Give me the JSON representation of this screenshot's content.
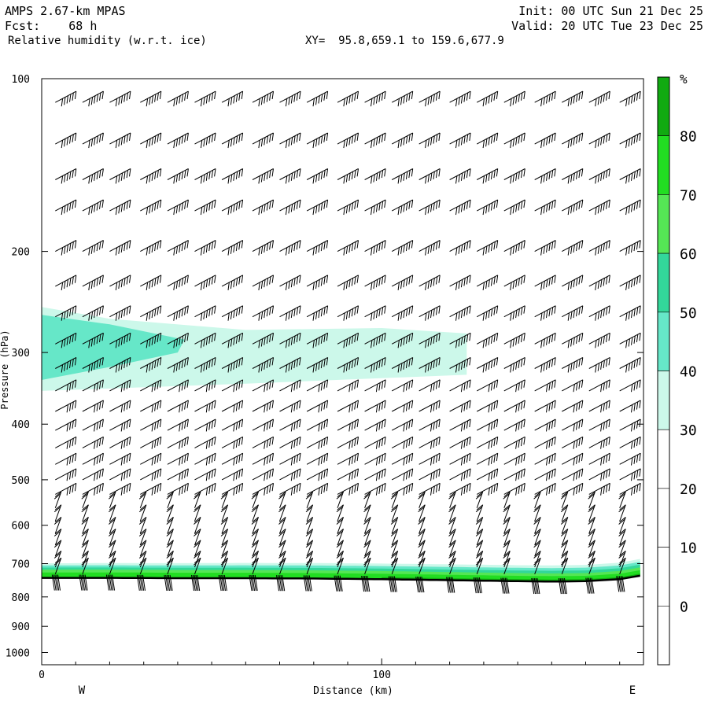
{
  "header": {
    "line1_left": "AMPS 2.67-km MPAS",
    "line2_left": "Fcst:    68 h",
    "line3_left": "Relative humidity (w.r.t. ice)",
    "line3_mid": "XY=  95.8,659.1 to 159.6,677.9",
    "line1_right": "Init: 00 UTC Sun 21 Dec 25",
    "line2_right": "Valid: 20 UTC Tue 23 Dec 25"
  },
  "colors": {
    "rh_20_30": "#ffffff",
    "rh_30_40": "#ccf8ea",
    "rh_40_50": "#66e7c8",
    "rh_50_60": "#33d79a",
    "rh_60_70": "#55e655",
    "rh_70_80": "#22dd22",
    "rh_80_plus": "#11aa11",
    "terrain_line": "#000000",
    "barb": "#000000"
  },
  "chart_data": {
    "type": "heatmap",
    "field": "Relative humidity (w.r.t. ice)",
    "xlabel": "Distance (km)",
    "ylabel": "Pressure (hPa)",
    "xlim": [
      0,
      177
    ],
    "ylim": [
      1050,
      100
    ],
    "y_scale": "log",
    "x_ticks": [
      0,
      100
    ],
    "y_ticks": [
      100,
      200,
      300,
      400,
      500,
      600,
      700,
      800,
      900,
      1000
    ],
    "x_end_labels": {
      "west": "W",
      "east": "E"
    },
    "grid": false,
    "colorbar": {
      "unit": "%",
      "position": "right",
      "labels": [
        80,
        70,
        60,
        50,
        40,
        30,
        20,
        10,
        0
      ]
    },
    "moist_layer_upper": {
      "description": "RH 30-50% plume aloft",
      "points_km_hpa": [
        [
          0,
          250
        ],
        [
          20,
          262
        ],
        [
          60,
          274
        ],
        [
          100,
          272
        ],
        [
          125,
          278
        ],
        [
          125,
          328
        ],
        [
          60,
          340
        ],
        [
          0,
          350
        ]
      ]
    },
    "terrain_surface_hpa": {
      "x_km": [
        0,
        20,
        40,
        60,
        80,
        100,
        120,
        140,
        150,
        160,
        170,
        177
      ],
      "p_hpa": [
        741,
        741,
        742,
        742,
        743,
        745,
        748,
        751,
        752,
        751,
        745,
        733
      ]
    },
    "wind_barbs": {
      "columns_km": [
        4,
        12,
        20,
        29,
        37,
        45,
        53,
        62,
        70,
        78,
        87,
        95,
        103,
        111,
        120,
        128,
        136,
        145,
        153,
        161,
        170
      ],
      "levels_hpa": [
        110,
        130,
        150,
        170,
        200,
        230,
        260,
        290,
        320,
        350,
        380,
        410,
        440,
        470,
        500,
        530,
        560,
        590,
        620,
        650,
        680,
        710,
        730
      ],
      "speed_kt_upper": 60,
      "speed_kt_mid": 40,
      "speed_kt_lower": 20
    }
  }
}
